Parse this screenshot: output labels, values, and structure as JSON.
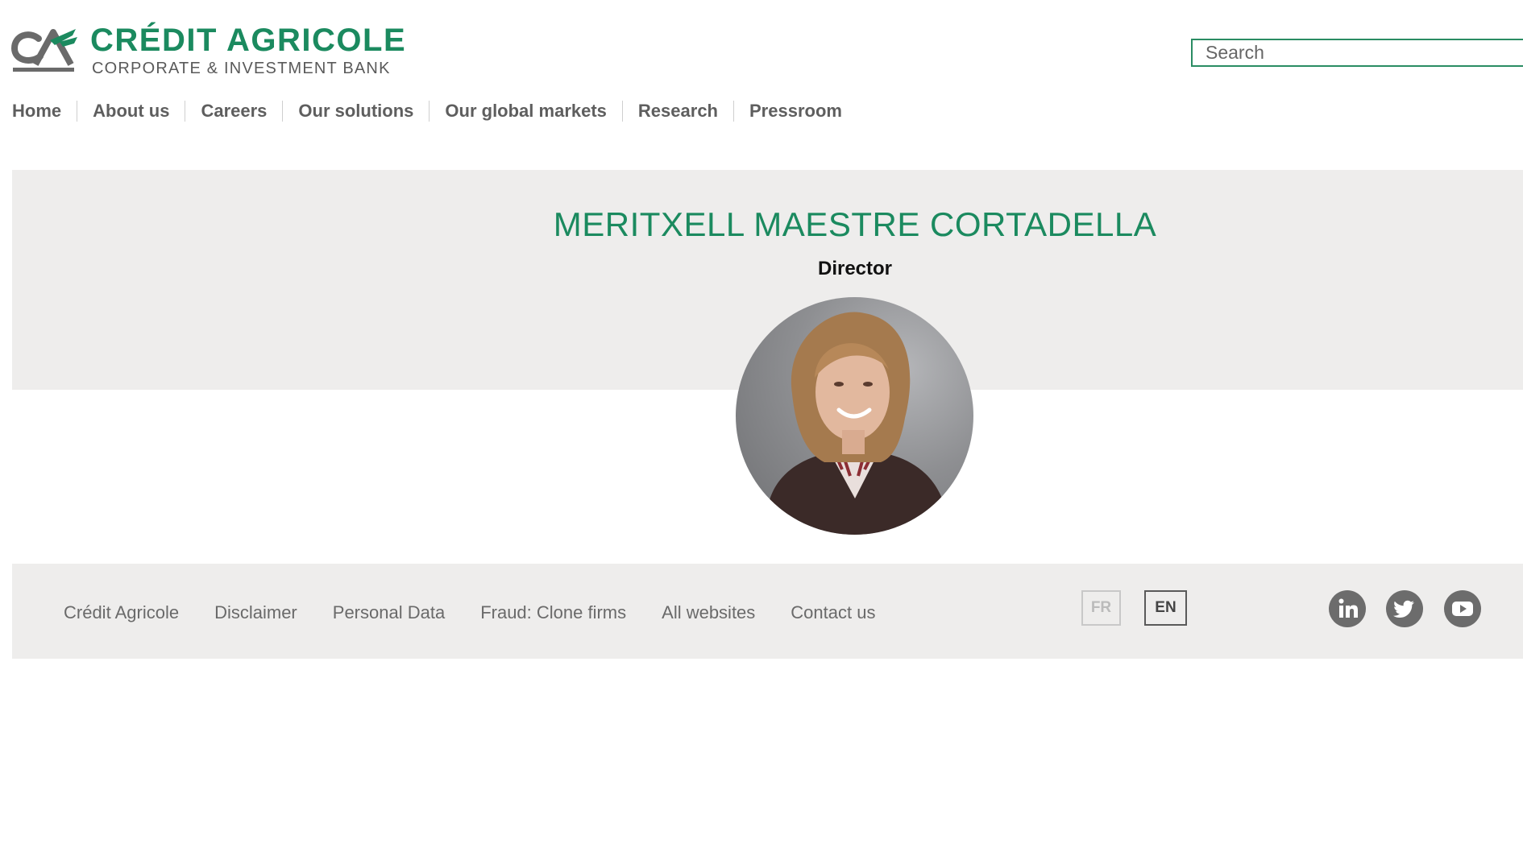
{
  "header": {
    "logo_monogram": "CA",
    "brand_name": "CRÉDIT AGRICOLE",
    "tagline": "CORPORATE & INVESTMENT BANK",
    "search": {
      "placeholder": "Search"
    }
  },
  "nav": {
    "items": [
      {
        "label": "Home"
      },
      {
        "label": "About us"
      },
      {
        "label": "Careers"
      },
      {
        "label": "Our solutions"
      },
      {
        "label": "Our global markets"
      },
      {
        "label": "Research"
      },
      {
        "label": "Pressroom"
      }
    ]
  },
  "profile": {
    "name": "MERITXELL MAESTRE CORTADELLA",
    "role": "Director"
  },
  "footer": {
    "links": [
      {
        "label": "Crédit Agricole"
      },
      {
        "label": "Disclaimer"
      },
      {
        "label": "Personal Data"
      },
      {
        "label": "Fraud: Clone firms"
      },
      {
        "label": "All websites"
      },
      {
        "label": "Contact us"
      }
    ],
    "languages": [
      {
        "code": "FR",
        "active": false
      },
      {
        "code": "EN",
        "active": true
      }
    ],
    "social": [
      {
        "icon": "linkedin-icon"
      },
      {
        "icon": "twitter-icon"
      },
      {
        "icon": "youtube-icon"
      }
    ]
  },
  "colors": {
    "brand_green": "#1b8a5f",
    "panel_gray": "#eeedec",
    "nav_text": "#5e5e5e",
    "social_gray": "#6c6c6c"
  }
}
